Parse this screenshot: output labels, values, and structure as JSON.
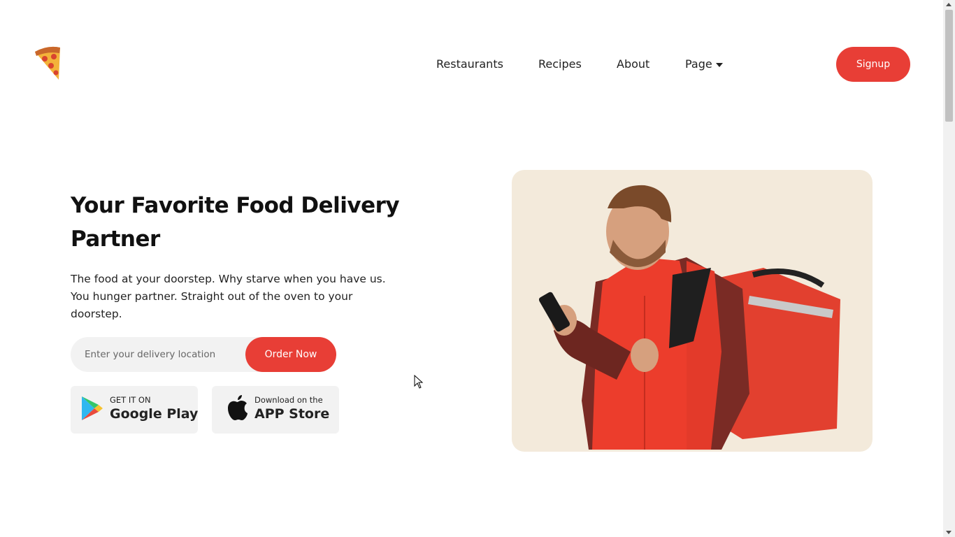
{
  "brand": {
    "logo_icon": "pizza-slice-icon"
  },
  "nav": {
    "items": [
      "Restaurants",
      "Recipes",
      "About"
    ],
    "dropdown_label": "Page",
    "dropdown_icon": "caret-down-icon"
  },
  "signup_label": "Signup",
  "hero": {
    "title_line1": "Your Favorite Food Delivery",
    "title_line2": "Partner",
    "description": "The food at your doorstep. Why starve when you have us. You hunger partner. Straight out of the oven to your doorstep.",
    "input_placeholder": "Enter your delivery location",
    "order_label": "Order Now",
    "image_icon": "delivery-man-photo"
  },
  "stores": {
    "google": {
      "small": "GET IT ON",
      "big": "Google Play",
      "icon": "google-play-icon"
    },
    "apple": {
      "small": "Download on the",
      "big": "APP Store",
      "icon": "apple-icon"
    }
  },
  "colors": {
    "accent": "#e83e36",
    "card_bg": "#f3eadb",
    "input_bg": "#f2f2f2"
  }
}
